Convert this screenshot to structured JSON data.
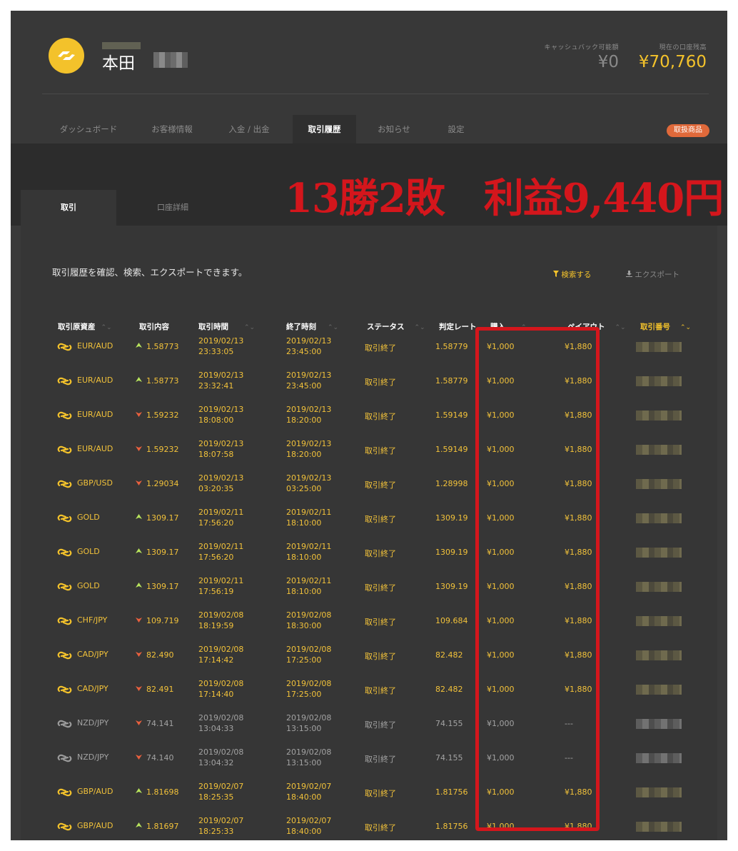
{
  "header": {
    "user_name": "本田",
    "cashback_label": "キャッシュバック可能額",
    "cashback_value": "¥0",
    "balance_label": "現在の口座残高",
    "balance_value": "¥70,760"
  },
  "nav": {
    "tabs": [
      "ダッシュボード",
      "お客様情報",
      "入金 / 出金",
      "取引履歴",
      "お知らせ",
      "設定"
    ],
    "active": "取引履歴",
    "product_button": "取扱商品"
  },
  "sub_tabs": [
    "取引",
    "口座詳細"
  ],
  "banner": "13勝2敗　利益9,440円",
  "intro": "取引履歴を確認、検索、エクスポートできます。",
  "actions": {
    "search": "検索する",
    "export": "エクスポート"
  },
  "columns": [
    "取引原資産",
    "取引内容",
    "取引時間",
    "終了時刻",
    "ステータス",
    "判定レート",
    "購入",
    "ペイアウト",
    "取引番号"
  ],
  "rows": [
    {
      "asset": "EUR/AUD",
      "dir": "up",
      "rate": "1.58773",
      "start_date": "2019/02/13",
      "start_time": "23:33:05",
      "end_date": "2019/02/13",
      "end_time": "23:45:00",
      "status": "取引終了",
      "judge": "1.58779",
      "purchase": "¥1,000",
      "payout": "¥1,880",
      "active": true
    },
    {
      "asset": "EUR/AUD",
      "dir": "up",
      "rate": "1.58773",
      "start_date": "2019/02/13",
      "start_time": "23:32:41",
      "end_date": "2019/02/13",
      "end_time": "23:45:00",
      "status": "取引終了",
      "judge": "1.58779",
      "purchase": "¥1,000",
      "payout": "¥1,880",
      "active": true
    },
    {
      "asset": "EUR/AUD",
      "dir": "down",
      "rate": "1.59232",
      "start_date": "2019/02/13",
      "start_time": "18:08:00",
      "end_date": "2019/02/13",
      "end_time": "18:20:00",
      "status": "取引終了",
      "judge": "1.59149",
      "purchase": "¥1,000",
      "payout": "¥1,880",
      "active": true
    },
    {
      "asset": "EUR/AUD",
      "dir": "down",
      "rate": "1.59232",
      "start_date": "2019/02/13",
      "start_time": "18:07:58",
      "end_date": "2019/02/13",
      "end_time": "18:20:00",
      "status": "取引終了",
      "judge": "1.59149",
      "purchase": "¥1,000",
      "payout": "¥1,880",
      "active": true
    },
    {
      "asset": "GBP/USD",
      "dir": "down",
      "rate": "1.29034",
      "start_date": "2019/02/13",
      "start_time": "03:20:35",
      "end_date": "2019/02/13",
      "end_time": "03:25:00",
      "status": "取引終了",
      "judge": "1.28998",
      "purchase": "¥1,000",
      "payout": "¥1,880",
      "active": true
    },
    {
      "asset": "GOLD",
      "dir": "up",
      "rate": "1309.17",
      "start_date": "2019/02/11",
      "start_time": "17:56:20",
      "end_date": "2019/02/11",
      "end_time": "18:10:00",
      "status": "取引終了",
      "judge": "1309.19",
      "purchase": "¥1,000",
      "payout": "¥1,880",
      "active": true
    },
    {
      "asset": "GOLD",
      "dir": "up",
      "rate": "1309.17",
      "start_date": "2019/02/11",
      "start_time": "17:56:20",
      "end_date": "2019/02/11",
      "end_time": "18:10:00",
      "status": "取引終了",
      "judge": "1309.19",
      "purchase": "¥1,000",
      "payout": "¥1,880",
      "active": true
    },
    {
      "asset": "GOLD",
      "dir": "up",
      "rate": "1309.17",
      "start_date": "2019/02/11",
      "start_time": "17:56:19",
      "end_date": "2019/02/11",
      "end_time": "18:10:00",
      "status": "取引終了",
      "judge": "1309.19",
      "purchase": "¥1,000",
      "payout": "¥1,880",
      "active": true
    },
    {
      "asset": "CHF/JPY",
      "dir": "down",
      "rate": "109.719",
      "start_date": "2019/02/08",
      "start_time": "18:19:59",
      "end_date": "2019/02/08",
      "end_time": "18:30:00",
      "status": "取引終了",
      "judge": "109.684",
      "purchase": "¥1,000",
      "payout": "¥1,880",
      "active": true
    },
    {
      "asset": "CAD/JPY",
      "dir": "down",
      "rate": "82.490",
      "start_date": "2019/02/08",
      "start_time": "17:14:42",
      "end_date": "2019/02/08",
      "end_time": "17:25:00",
      "status": "取引終了",
      "judge": "82.482",
      "purchase": "¥1,000",
      "payout": "¥1,880",
      "active": true
    },
    {
      "asset": "CAD/JPY",
      "dir": "down",
      "rate": "82.491",
      "start_date": "2019/02/08",
      "start_time": "17:14:40",
      "end_date": "2019/02/08",
      "end_time": "17:25:00",
      "status": "取引終了",
      "judge": "82.482",
      "purchase": "¥1,000",
      "payout": "¥1,880",
      "active": true
    },
    {
      "asset": "NZD/JPY",
      "dir": "down",
      "rate": "74.141",
      "start_date": "2019/02/08",
      "start_time": "13:04:33",
      "end_date": "2019/02/08",
      "end_time": "13:15:00",
      "status": "取引終了",
      "judge": "74.155",
      "purchase": "¥1,000",
      "payout": "---",
      "active": false
    },
    {
      "asset": "NZD/JPY",
      "dir": "down",
      "rate": "74.140",
      "start_date": "2019/02/08",
      "start_time": "13:04:32",
      "end_date": "2019/02/08",
      "end_time": "13:15:00",
      "status": "取引終了",
      "judge": "74.155",
      "purchase": "¥1,000",
      "payout": "---",
      "active": false
    },
    {
      "asset": "GBP/AUD",
      "dir": "up",
      "rate": "1.81698",
      "start_date": "2019/02/07",
      "start_time": "18:25:35",
      "end_date": "2019/02/07",
      "end_time": "18:40:00",
      "status": "取引終了",
      "judge": "1.81756",
      "purchase": "¥1,000",
      "payout": "¥1,880",
      "active": true
    },
    {
      "asset": "GBP/AUD",
      "dir": "up",
      "rate": "1.81697",
      "start_date": "2019/02/07",
      "start_time": "18:25:33",
      "end_date": "2019/02/07",
      "end_time": "18:40:00",
      "status": "取引終了",
      "judge": "1.81756",
      "purchase": "¥1,000",
      "payout": "¥1,880",
      "active": true
    }
  ],
  "colors": {
    "accent": "#f3c22b",
    "win_text": "#f2c23a",
    "muted_text": "#a3a3a3",
    "up_arrow": "#b7e35c",
    "down_arrow": "#e9603e",
    "banner_red": "#d4161c"
  },
  "icons": {
    "logo": "exchange-logo-icon",
    "asset": "chain-link-icon",
    "up": "up-arrow-icon",
    "down": "down-arrow-icon",
    "sort": "sort-chevrons-icon",
    "filter": "filter-icon",
    "download": "download-icon"
  }
}
